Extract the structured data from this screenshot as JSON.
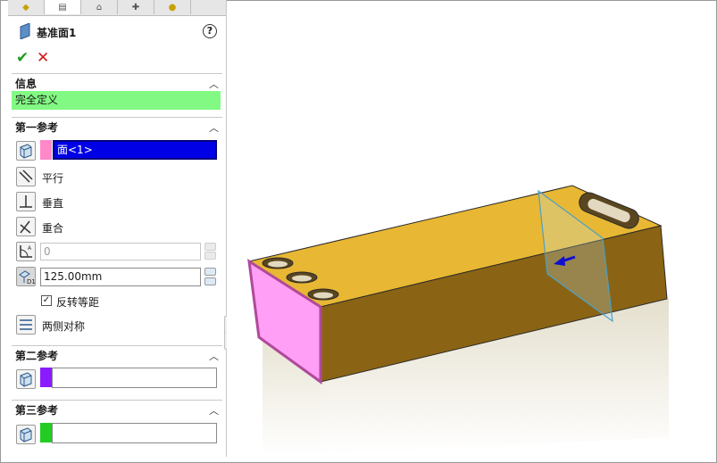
{
  "feature": {
    "title": "基准面1",
    "help_icon": "?",
    "ok_icon": "✔",
    "cancel_icon": "✕"
  },
  "tabs": [
    {
      "icon": "feature-manager-icon"
    },
    {
      "icon": "property-manager-icon"
    },
    {
      "icon": "configuration-manager-icon"
    },
    {
      "icon": "dimxpert-icon"
    },
    {
      "icon": "display-manager-icon"
    }
  ],
  "info": {
    "header": "信息",
    "status": "完全定义",
    "status_color": "#82f982"
  },
  "first_ref": {
    "header": "第一参考",
    "selection": "面<1>",
    "selection_color": "#ff88c8",
    "options": {
      "parallel": "平行",
      "perpendicular": "垂直",
      "coincident": "重合"
    },
    "angle_value": "0",
    "distance_value": "125.00mm",
    "flip_label": "反转等距",
    "flip_checked": true,
    "symmetric_label": "两侧对称"
  },
  "second_ref": {
    "header": "第二参考",
    "color": "#8a1bff"
  },
  "third_ref": {
    "header": "第三参考",
    "color": "#22cc22"
  },
  "colors": {
    "accent_selection": "#0000e6",
    "part_top": "#e8b733",
    "part_front": "#8a6414"
  }
}
